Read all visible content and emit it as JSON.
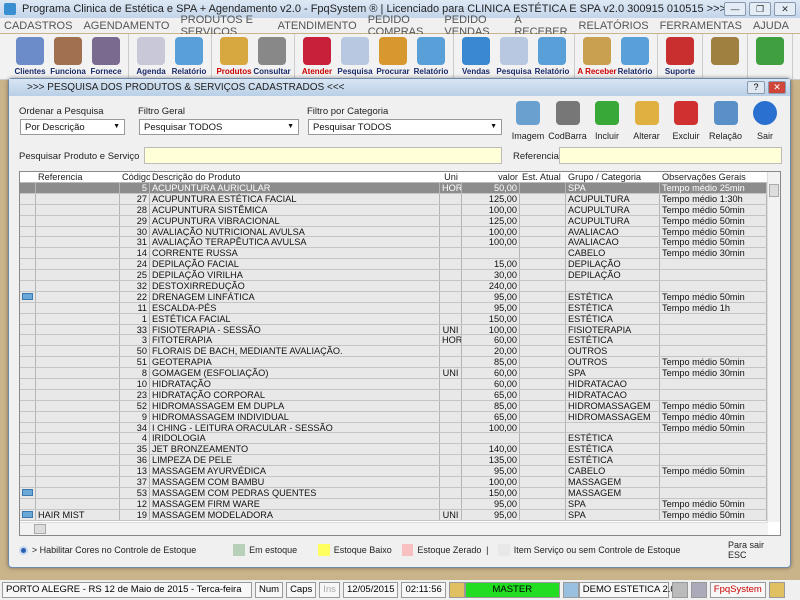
{
  "window": {
    "title": "Programa Clinica de Estética e SPA + Agendamento v2.0 - FpqSystem ® | Licenciado para  CLINICA ESTÉTICA E SPA v2.0 300915 010515 >>>"
  },
  "menu": [
    "CADASTROS",
    "AGENDAMENTO",
    "PRODUTOS E SERVIÇOS",
    "ATENDIMENTO",
    "PEDIDO COMPRAS",
    "PEDIDO VENDAS",
    "A RECEBER",
    "RELATÓRIOS",
    "FERRAMENTAS",
    "AJUDA"
  ],
  "toolbar": [
    [
      {
        "label": "Clientes",
        "icon": "clients-icon",
        "color": "#6b8cc8"
      },
      {
        "label": "Funciona",
        "icon": "employees-icon",
        "color": "#a07050"
      },
      {
        "label": "Fornece",
        "icon": "suppliers-icon",
        "color": "#7a6a90"
      }
    ],
    [
      {
        "label": "Agenda",
        "icon": "calendar-icon",
        "color": "#c8c8d8"
      },
      {
        "label": "Relatório",
        "icon": "report-icon",
        "color": "#5aa0d8"
      }
    ],
    [
      {
        "label": "Produtos",
        "icon": "products-icon",
        "color": "#d8a840",
        "red": true
      },
      {
        "label": "Consultar",
        "icon": "barcode-icon",
        "color": "#888"
      }
    ],
    [
      {
        "label": "Atender",
        "icon": "attend-icon",
        "color": "#c8203a",
        "red": true
      },
      {
        "label": "Pesquisa",
        "icon": "search-doc-icon",
        "color": "#b8c8e0"
      },
      {
        "label": "Procurar",
        "icon": "folder-icon",
        "color": "#d89830"
      },
      {
        "label": "Relatório",
        "icon": "report-icon",
        "color": "#5aa0d8"
      }
    ],
    [
      {
        "label": "Vendas",
        "icon": "monitor-icon",
        "color": "#3a88d0"
      },
      {
        "label": "Pesquisa",
        "icon": "search-doc-icon",
        "color": "#b8c8e0"
      },
      {
        "label": "Relatório",
        "icon": "report-icon",
        "color": "#5aa0d8"
      }
    ],
    [
      {
        "label": "A Receber",
        "icon": "money-icon",
        "color": "#c8a050",
        "red": true
      },
      {
        "label": "Relatório",
        "icon": "report-icon",
        "color": "#5aa0d8"
      }
    ],
    [
      {
        "label": "Suporte",
        "icon": "support-icon",
        "color": "#c83030"
      }
    ],
    [
      {
        "label": "",
        "icon": "coin-icon",
        "color": "#a08040"
      }
    ],
    [
      {
        "label": "",
        "icon": "exit-door-icon",
        "color": "#40a040"
      }
    ]
  ],
  "dialog": {
    "title": ">>>  PESQUISA DOS PRODUTOS & SERVIÇOS CADASTRADOS  <<<",
    "help": "?",
    "close": "✕",
    "order_label": "Ordenar a Pesquisa",
    "order_value": "Por Descrição",
    "filter_label": "Filtro Geral",
    "filter_value": "Pesquisar TODOS",
    "category_label": "Filtro por Categoria",
    "category_value": "Pesquisar TODOS",
    "search_label": "Pesquisar Produto e Serviço",
    "search_value": "",
    "ref_label": "Referencia",
    "ref_value": "",
    "actions": [
      {
        "label": "Imagem",
        "icon": "image-icon",
        "color": "#6aa0d0"
      },
      {
        "label": "CodBarra",
        "icon": "barcode-icon",
        "color": "#777"
      },
      {
        "label": "Incluir",
        "icon": "add-icon",
        "color": "#38a838"
      },
      {
        "label": "Alterar",
        "icon": "edit-icon",
        "color": "#e0b040"
      },
      {
        "label": "Excluir",
        "icon": "delete-icon",
        "color": "#d03030"
      },
      {
        "label": "Relação",
        "icon": "print-icon",
        "color": "#5a90c8"
      },
      {
        "label": "Sair",
        "icon": "exit-arrow-icon",
        "color": "#2a70d0"
      }
    ]
  },
  "table": {
    "columns": [
      "",
      "Referencia",
      "Código",
      "Descrição do Produto",
      "Uni",
      "valor",
      "Est. Atual",
      "Grupo / Categoria",
      "Observações Gerais"
    ],
    "rows": [
      [
        "",
        "",
        "5",
        "ACUPUNTURA AURICULAR",
        "HOR",
        "50,00",
        "",
        "SPA",
        "Tempo médio 25min"
      ],
      [
        "",
        "",
        "27",
        "ACUPUNTURA ESTÉTICA FACIAL",
        "",
        "125,00",
        "",
        "ACUPULTURA",
        "Tempo médio 1:30h"
      ],
      [
        "",
        "",
        "28",
        "ACUPUNTURA SISTÊMICA",
        "",
        "100,00",
        "",
        "ACUPULTURA",
        "Tempo médio 50min"
      ],
      [
        "",
        "",
        "29",
        "ACUPUNTURA VIBRACIONAL",
        "",
        "125,00",
        "",
        "ACUPULTURA",
        "Tempo médio 50min"
      ],
      [
        "",
        "",
        "30",
        "AVALIAÇÃO NUTRICIONAL AVULSA",
        "",
        "100,00",
        "",
        "AVALIACAO",
        "Tempo médio 50min"
      ],
      [
        "",
        "",
        "31",
        "AVALIAÇÃO TERAPÊUTICA AVULSA",
        "",
        "100,00",
        "",
        "AVALIACAO",
        "Tempo médio 50min"
      ],
      [
        "",
        "",
        "14",
        "CORRENTE RUSSA",
        "",
        "",
        "",
        "CABELO",
        "Tempo médio 30min"
      ],
      [
        "",
        "",
        "24",
        "DEPILAÇÃO FACIAL",
        "",
        "15,00",
        "",
        "DEPILAÇÃO",
        ""
      ],
      [
        "",
        "",
        "25",
        "DEPILAÇÃO VIRILHA",
        "",
        "30,00",
        "",
        "DEPILAÇÃO",
        ""
      ],
      [
        "",
        "",
        "32",
        "DESTOXIRREDUÇÃO",
        "",
        "240,00",
        "",
        "",
        ""
      ],
      [
        "img",
        "",
        "22",
        "DRENAGEM LINFÁTICA",
        "",
        "95,00",
        "",
        "ESTÉTICA",
        "Tempo médio 50min"
      ],
      [
        "",
        "",
        "11",
        "ESCALDA-PÉS",
        "",
        "95,00",
        "",
        "ESTÉTICA",
        "Tempo médio 1h"
      ],
      [
        "",
        "",
        "1",
        "ESTÉTICA FACIAL",
        "",
        "150,00",
        "",
        "ESTÉTICA",
        ""
      ],
      [
        "",
        "",
        "33",
        "FISIOTERAPIA - SESSÃO",
        "UNI",
        "100,00",
        "",
        "FISIOTERAPIA",
        ""
      ],
      [
        "",
        "",
        "3",
        "FITOTERAPIA",
        "HOR",
        "60,00",
        "",
        "ESTÉTICA",
        ""
      ],
      [
        "",
        "",
        "50",
        "FLORAIS DE BACH, MEDIANTE AVALIAÇÃO.",
        "",
        "20,00",
        "",
        "OUTROS",
        ""
      ],
      [
        "",
        "",
        "51",
        "GEOTERAPIA",
        "",
        "85,00",
        "",
        "OUTROS",
        "Tempo médio 50min"
      ],
      [
        "",
        "",
        "8",
        "GOMAGEM (ESFOLIAÇÃO)",
        "UNI",
        "60,00",
        "",
        "SPA",
        "Tempo médio 30min"
      ],
      [
        "",
        "",
        "10",
        "HIDRATAÇÃO",
        "",
        "60,00",
        "",
        "HIDRATACAO",
        ""
      ],
      [
        "",
        "",
        "23",
        "HIDRATAÇÃO CORPORAL",
        "",
        "65,00",
        "",
        "HIDRATACAO",
        ""
      ],
      [
        "",
        "",
        "52",
        "HIDROMASSAGEM EM DUPLA",
        "",
        "85,00",
        "",
        "HIDROMASSAGEM",
        "Tempo médio 50min"
      ],
      [
        "",
        "",
        "9",
        "HIDROMASSAGEM INDIVIDUAL",
        "",
        "65,00",
        "",
        "HIDROMASSAGEM",
        "Tempo médio 40min"
      ],
      [
        "",
        "",
        "34",
        "I CHING - LEITURA ORACULAR - SESSÃO",
        "",
        "100,00",
        "",
        "",
        "Tempo médio 50min"
      ],
      [
        "",
        "",
        "4",
        "IRIDOLOGIA",
        "",
        "",
        "",
        "ESTÉTICA",
        ""
      ],
      [
        "",
        "",
        "35",
        "JET BRONZEAMENTO",
        "",
        "140,00",
        "",
        "ESTÉTICA",
        ""
      ],
      [
        "",
        "",
        "36",
        "LIMPEZA DE PELE",
        "",
        "135,00",
        "",
        "ESTÉTICA",
        ""
      ],
      [
        "",
        "",
        "13",
        "MASSAGEM AYURVÉDICA",
        "",
        "95,00",
        "",
        "CABELO",
        "Tempo médio 50min"
      ],
      [
        "",
        "",
        "37",
        "MASSAGEM COM BAMBU",
        "",
        "100,00",
        "",
        "MASSAGEM",
        ""
      ],
      [
        "img",
        "",
        "53",
        "MASSAGEM COM PEDRAS QUENTES",
        "",
        "150,00",
        "",
        "MASSAGEM",
        ""
      ],
      [
        "",
        "",
        "12",
        "MASSAGEM FIRM WARE",
        "",
        "95,00",
        "",
        "SPA",
        "Tempo médio 50min"
      ],
      [
        "img",
        "HAIR MIST",
        "19",
        "MASSAGEM MODELADORA",
        "UNI",
        "95,00",
        "",
        "SPA",
        "Tempo médio 50min"
      ]
    ]
  },
  "legend": {
    "enable": "> Habilitar Cores no Controle de Estoque",
    "in_stock": "Em estoque",
    "in_stock_color": "#b8d0b8",
    "low": "Estoque Baixo",
    "low_color": "#ffff60",
    "zero": "Estoque Zerado",
    "zero_color": "#f8c0c0",
    "sep": "|",
    "service": "Item Serviço ou sem Controle de Estoque",
    "service_color": "#e8e8e8",
    "exit_hint": "Para sair ESC"
  },
  "status": {
    "location": "PORTO ALEGRE - RS 12 de Maio de 2015 - Terca-feira",
    "num": "Num",
    "caps": "Caps",
    "ins": "Ins",
    "date": "12/05/2015",
    "time": "02:11:56",
    "user": "MASTER",
    "company": "DEMO ESTETICA 2.0",
    "brand": "FpqSystem"
  }
}
